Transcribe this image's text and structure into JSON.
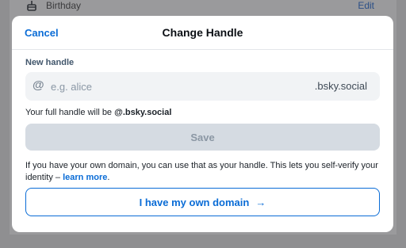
{
  "background": {
    "row_label": "Birthday",
    "edit_label": "Edit"
  },
  "modal": {
    "cancel_label": "Cancel",
    "title": "Change Handle",
    "field_label": "New handle",
    "input": {
      "value": "",
      "placeholder": "e.g. alice",
      "prefix_icon": "at-icon",
      "suffix": ".bsky.social"
    },
    "full_handle_prefix": "Your full handle will be ",
    "full_handle_value": "@.bsky.social",
    "save_label": "Save",
    "own_domain_text": "If you have your own domain, you can use that as your handle. This lets you self-verify your identity – ",
    "learn_more_label": "learn more",
    "own_domain_text_end": ".",
    "own_domain_button": "I have my own domain",
    "own_domain_arrow": "→"
  },
  "colors": {
    "accent": "#0a6cd6",
    "save_disabled_bg": "#d5dbe2",
    "overlay": "#8f8f91"
  }
}
